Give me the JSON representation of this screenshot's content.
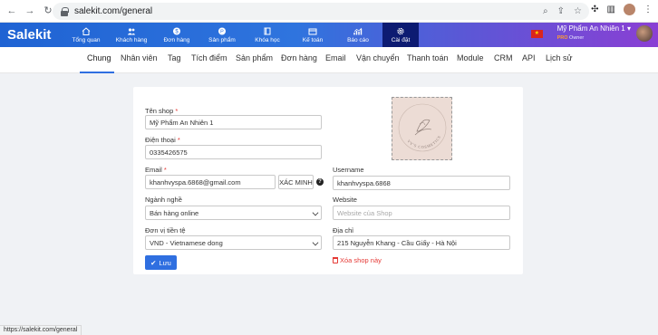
{
  "browser": {
    "url": "salekit.com/general",
    "status_url": "https://salekit.com/general"
  },
  "app": {
    "logo": "Salekit",
    "menu": [
      {
        "label": "Tổng quan",
        "icon": "home-icon"
      },
      {
        "label": "Khách hàng",
        "icon": "customers-icon"
      },
      {
        "label": "Đơn hàng",
        "icon": "orders-icon"
      },
      {
        "label": "Sản phẩm",
        "icon": "products-icon"
      },
      {
        "label": "Khóa học",
        "icon": "book-icon"
      },
      {
        "label": "Kế toán",
        "icon": "accounting-icon"
      },
      {
        "label": "Báo cáo",
        "icon": "report-icon"
      },
      {
        "label": "Cài đặt",
        "icon": "settings-icon"
      }
    ],
    "user": {
      "name": "Mỹ Phẩm An Nhiên 1",
      "plan": "PRO",
      "role": "Owner"
    }
  },
  "subnav": {
    "tabs": [
      "Chung",
      "Nhân viên",
      "Tag",
      "Tích điểm",
      "Sản phẩm",
      "Đơn hàng",
      "Email",
      "Vận chuyển",
      "Thanh toán",
      "Module",
      "CRM",
      "API",
      "Lịch sử"
    ],
    "active": "Chung"
  },
  "form": {
    "shop_name": {
      "label": "Tên shop",
      "required": "*",
      "value": "Mỹ Phẩm An Nhiên 1"
    },
    "phone": {
      "label": "Điện thoại",
      "required": "*",
      "value": "0335426575"
    },
    "email": {
      "label": "Email",
      "required": "*",
      "value": "khanhvyspa.6868@gmail.com",
      "verify_label": "XÁC MINH"
    },
    "industry": {
      "label": "Ngành nghề",
      "value": "Bán hàng online"
    },
    "currency": {
      "label": "Đơn vị tiền tệ",
      "value": "VND - Vietnamese dong"
    },
    "username": {
      "label": "Username",
      "value": "khanhvyspa.6868"
    },
    "website": {
      "label": "Website",
      "placeholder": "Website của Shop"
    },
    "address": {
      "label": "Địa chỉ",
      "value": "215 Nguyễn Khang - Cầu Giấy - Hà Nội"
    },
    "save_label": "Lưu",
    "delete_label": "Xóa shop này"
  },
  "logo_text": "VY'S COSMETICS",
  "colors": {
    "primary": "#2f6fe0",
    "danger": "#e53935",
    "active_menu": "#0d1b72"
  }
}
